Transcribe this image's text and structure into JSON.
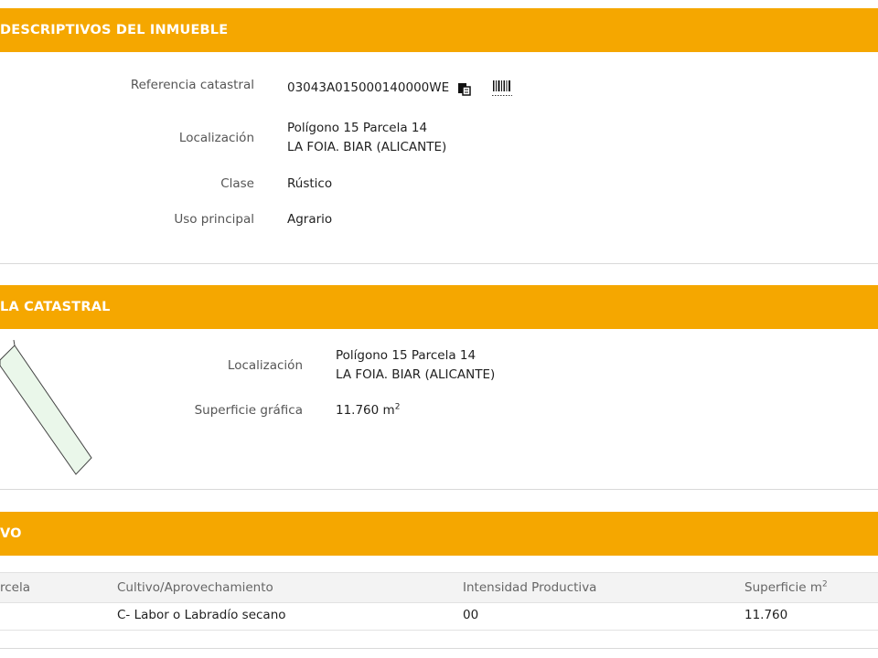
{
  "colors": {
    "accent": "#f5a700",
    "header_text": "#ffffff"
  },
  "section1": {
    "title": "DESCRIPTIVOS DEL INMUEBLE",
    "fields": {
      "referencia_label": "Referencia catastral",
      "referencia_value": "03043A015000140000WE",
      "copy_icon": "copy-icon",
      "barcode_icon": "barcode-icon",
      "localizacion_label": "Localización",
      "localizacion_line1": "Polígono 15 Parcela 14",
      "localizacion_line2": "LA FOIA. BIAR (ALICANTE)",
      "clase_label": "Clase",
      "clase_value": "Rústico",
      "uso_label": "Uso principal",
      "uso_value": "Agrario"
    }
  },
  "section2": {
    "title": "LA CATASTRAL",
    "fields": {
      "localizacion_label": "Localización",
      "localizacion_line1": "Polígono 15 Parcela 14",
      "localizacion_line2": "LA FOIA. BIAR (ALICANTE)",
      "superficie_label": "Superficie gráfica",
      "superficie_value": "11.760 m",
      "superficie_unit_sup": "2"
    }
  },
  "section3": {
    "title": "VO",
    "table": {
      "headers": {
        "parcela": "rcela",
        "cultivo": "Cultivo/Aprovechamiento",
        "intensidad": "Intensidad Productiva",
        "superficie": "Superficie m",
        "superficie_sup": "2"
      },
      "rows": [
        {
          "cultivo": "C- Labor o Labradío secano",
          "intensidad": "00",
          "superficie": "11.760"
        }
      ]
    }
  }
}
